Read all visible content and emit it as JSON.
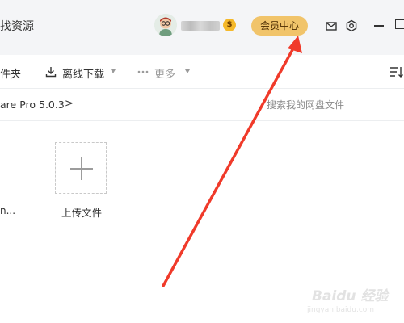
{
  "header": {
    "left_text": "找资源",
    "coin_badge": "$",
    "vip_button": "会员中心"
  },
  "toolbar": {
    "folder_label": "件夹",
    "offline_download": "离线下载",
    "more": "更多"
  },
  "path": {
    "current": "are Pro 5.0.3",
    "separator": ">"
  },
  "search": {
    "placeholder": "搜索我的网盘文件"
  },
  "files": {
    "partial_name": "n...",
    "upload_label": "上传文件"
  },
  "watermark": {
    "text": "Baidu 经验",
    "url": "jingyan.baidu.com"
  },
  "colors": {
    "vip_gold": "#f1c46a",
    "coin_gold": "#f5b92b",
    "arrow_red": "#f03a2a",
    "header_bg": "#f4f5f7"
  },
  "icons": [
    "avatar-icon",
    "coin-icon",
    "mail-icon",
    "settings-icon",
    "minimize-icon",
    "maximize-icon",
    "download-icon",
    "more-dots-icon",
    "sort-icon",
    "plus-icon"
  ]
}
